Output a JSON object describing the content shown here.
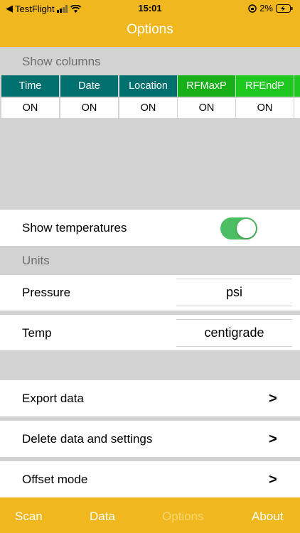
{
  "status_bar": {
    "back_app": "TestFlight",
    "time": "15:01",
    "battery": "2%"
  },
  "header": {
    "title": "Options"
  },
  "sections": {
    "show_columns": "Show columns",
    "units": "Units"
  },
  "columns": [
    {
      "name": "Time",
      "value": "ON",
      "color": "#00706e"
    },
    {
      "name": "Date",
      "value": "ON",
      "color": "#00706e"
    },
    {
      "name": "Location",
      "value": "ON",
      "color": "#00706e"
    },
    {
      "name": "RFMaxP",
      "value": "ON",
      "color": "#18b018"
    },
    {
      "name": "RFEndP",
      "value": "ON",
      "color": "#1ec81e"
    }
  ],
  "temperatures": {
    "label": "Show temperatures",
    "enabled": true,
    "toggle_color": "#4cbe64"
  },
  "units": {
    "pressure": {
      "label": "Pressure",
      "value": "psi"
    },
    "temp": {
      "label": "Temp",
      "value": "centigrade"
    }
  },
  "actions": [
    {
      "label": "Export data",
      "chevron": ">"
    },
    {
      "label": "Delete data and settings",
      "chevron": ">"
    },
    {
      "label": "Offset mode",
      "chevron": ">"
    }
  ],
  "tabs": [
    {
      "label": "Scan"
    },
    {
      "label": "Data"
    },
    {
      "label": "Options"
    },
    {
      "label": "About"
    }
  ],
  "colors": {
    "brand": "#f0b81e"
  }
}
